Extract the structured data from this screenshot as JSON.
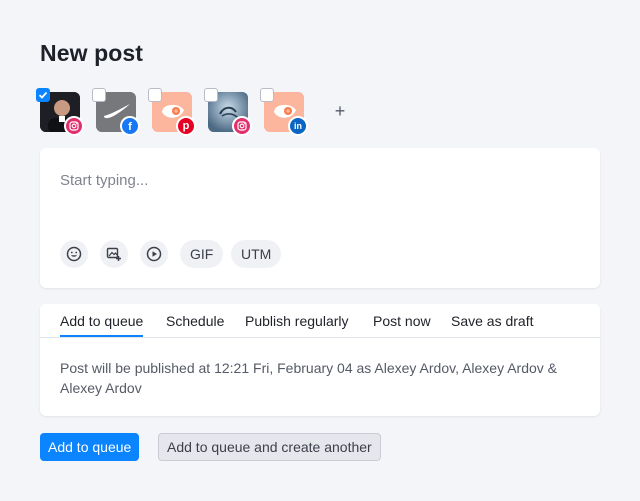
{
  "page": {
    "title": "New post"
  },
  "accounts": [
    {
      "avatar": "person-portrait",
      "network": "instagram",
      "checked": true
    },
    {
      "avatar": "nike-logo",
      "network": "facebook",
      "checked": false
    },
    {
      "avatar": "semrush-logo",
      "network": "pinterest",
      "checked": false
    },
    {
      "avatar": "virgin-logo",
      "network": "instagram",
      "checked": false
    },
    {
      "avatar": "semrush-logo",
      "network": "linkedin",
      "checked": false
    }
  ],
  "add_account_symbol": "+",
  "composer": {
    "placeholder": "Start typing...",
    "tools": [
      "emoji-icon",
      "add-image-icon",
      "video-icon"
    ],
    "gif_label": "GIF",
    "utm_label": "UTM"
  },
  "tabs": [
    {
      "label": "Add to queue",
      "active": true
    },
    {
      "label": "Schedule",
      "active": false
    },
    {
      "label": "Publish regularly",
      "active": false
    },
    {
      "label": "Post now",
      "active": false
    },
    {
      "label": "Save as draft",
      "active": false
    }
  ],
  "publish_info": "Post will be published at 12:21 Fri, February 04 as  Alexey Ardov,   Alexey Ardov &  Alexey Ardov",
  "buttons": {
    "primary": "Add to queue",
    "secondary": "Add to queue and create another"
  },
  "colors": {
    "accent": "#0a84ff",
    "instagram": "#e1306c",
    "facebook": "#1877f2",
    "pinterest": "#e60023",
    "linkedin": "#0a66c2",
    "semrush": "#ff642d"
  }
}
